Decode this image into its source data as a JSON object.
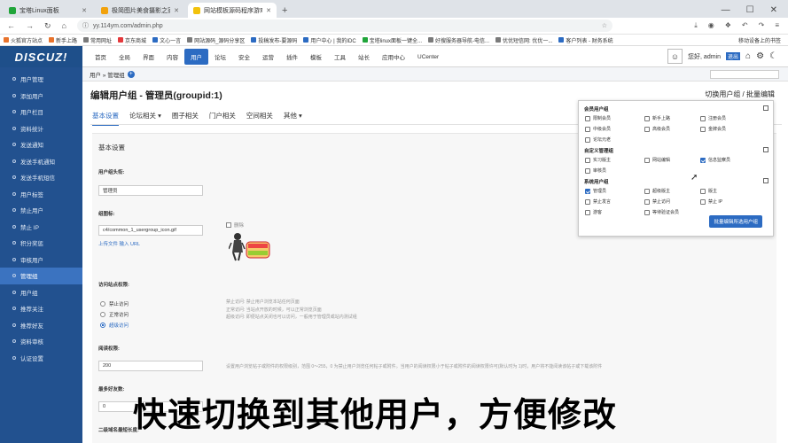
{
  "browser": {
    "tabs": [
      {
        "title": "宝塔Linux面板",
        "color": "#20a53a",
        "active": false
      },
      {
        "title": "极简图片美食摄影之家精品壁纸...",
        "color": "#f2a20c",
        "active": false
      },
      {
        "title": "网站模板源码程序游戏工具软件...",
        "color": "#f2c20c",
        "active": true
      }
    ],
    "new_tab": "+",
    "url": "yy.114ym.com/admin.php",
    "bookmarks": [
      {
        "label": "火狐官方站点",
        "color": "#e8732c"
      },
      {
        "label": "新手上路",
        "color": "#e8732c"
      },
      {
        "label": "常用网址",
        "color": "#7a7a7a"
      },
      {
        "label": "京东商城",
        "color": "#e4393c"
      },
      {
        "label": "文心一言",
        "color": "#2c6bc2"
      },
      {
        "label": "网站源码_源码分享区",
        "color": "#7a7a7a"
      },
      {
        "label": "投稿发布-要源码",
        "color": "#2c6bc2"
      },
      {
        "label": "用户中心 | 我的IDC",
        "color": "#2c6bc2"
      },
      {
        "label": "宝塔linux面板一键全...",
        "color": "#20a53a"
      },
      {
        "label": "好搜服务器导航-电信...",
        "color": "#7a7a7a"
      },
      {
        "label": "优优短信网: 优优一...",
        "color": "#7a7a7a"
      },
      {
        "label": "客户列表 - 财务系统",
        "color": "#2c6bc2"
      }
    ],
    "bookmarks_right": "移动设备上的书签"
  },
  "header": {
    "logo": "DISCUZ!",
    "nav": [
      "首页",
      "全局",
      "界面",
      "内容",
      "用户",
      "论坛",
      "安全",
      "运营",
      "插件",
      "模板",
      "工具",
      "站长",
      "应用中心",
      "UCenter"
    ],
    "active_nav": "用户",
    "greeting": "您好, admin",
    "logout": "退出"
  },
  "breadcrumb": {
    "text": "用户 » 管理组",
    "plus": "+"
  },
  "sidebar": {
    "items": [
      "用户管理",
      "添加用户",
      "用户栏目",
      "资料统计",
      "发送通知",
      "发送手机通知",
      "发送手机短信",
      "用户标签",
      "禁止用户",
      "禁止 IP",
      "积分奖惩",
      "审核用户",
      "管理组",
      "用户组",
      "推荐关注",
      "推荐好友",
      "资料审核",
      "认证设置"
    ],
    "active": "管理组"
  },
  "page": {
    "title": "编辑用户组 - 管理员(groupid:1)",
    "switch_link": "切换用户组 / 批量编辑",
    "tabs": [
      "基本设置",
      "论坛相关 ▾",
      "圈子相关",
      "门户相关",
      "空间相关",
      "其他 ▾"
    ],
    "active_tab": "基本设置",
    "section_title": "基本设置",
    "group_title_label": "用户组头衔:",
    "group_title_value": "管理员",
    "icon_label": "组图标:",
    "icon_value": "c4/common_1_usergroup_icon.gif",
    "icon_delete": "删除",
    "upload_text": "上传文件 输入 URL",
    "access_label": "访问站点权限:",
    "access_options": [
      "禁止访问",
      "正常访问",
      "超级访问"
    ],
    "access_selected": 2,
    "access_hints": [
      "禁止访问: 禁止用户浏览本站任何页面",
      "正常访问: 当站点开放的时候，可以正常浏览页面",
      "超级访问: 即便站点关闭也可以访问，一般用于管理员或站内测试组"
    ],
    "read_label": "阅读权限:",
    "read_value": "200",
    "read_hint": "设置用户浏览帖子或附件的权限级别，范围 0～255，0 为禁止用户浏览任何帖子或附件。当用户的阅读权限小于帖子或附件的阅读权限许可(默认时为 1)时，用户将不能阅读该帖子或下载该附件",
    "friends_label": "最多好友数:",
    "friends_value": "0",
    "domain_label": "二级域名最短长度:"
  },
  "popup": {
    "groups": [
      {
        "title": "会员用户组",
        "items": [
          [
            "限制会员",
            false
          ],
          [
            "新手上路",
            false
          ],
          [
            "注册会员",
            false
          ],
          [
            "中级会员",
            false
          ],
          [
            "高级会员",
            false
          ],
          [
            "金牌会员",
            false
          ],
          [
            "论坛元老",
            false
          ]
        ]
      },
      {
        "title": "自定义管理组",
        "items": [
          [
            "实习版主",
            false
          ],
          [
            "网站编辑",
            false
          ],
          [
            "信息监察员",
            true
          ],
          [
            "审核员",
            false
          ]
        ]
      },
      {
        "title": "系统用户组",
        "items": [
          [
            "管理员",
            true
          ],
          [
            "超级版主",
            false
          ],
          [
            "版主",
            false
          ],
          [
            "禁止发言",
            false
          ],
          [
            "禁止访问",
            false
          ],
          [
            "禁止 IP",
            false
          ],
          [
            "游客",
            false
          ],
          [
            "等待验证会员",
            false
          ]
        ]
      }
    ],
    "button": "批量编辑所选用户组"
  },
  "subtitle": "快速切换到其他用户，方便修改"
}
